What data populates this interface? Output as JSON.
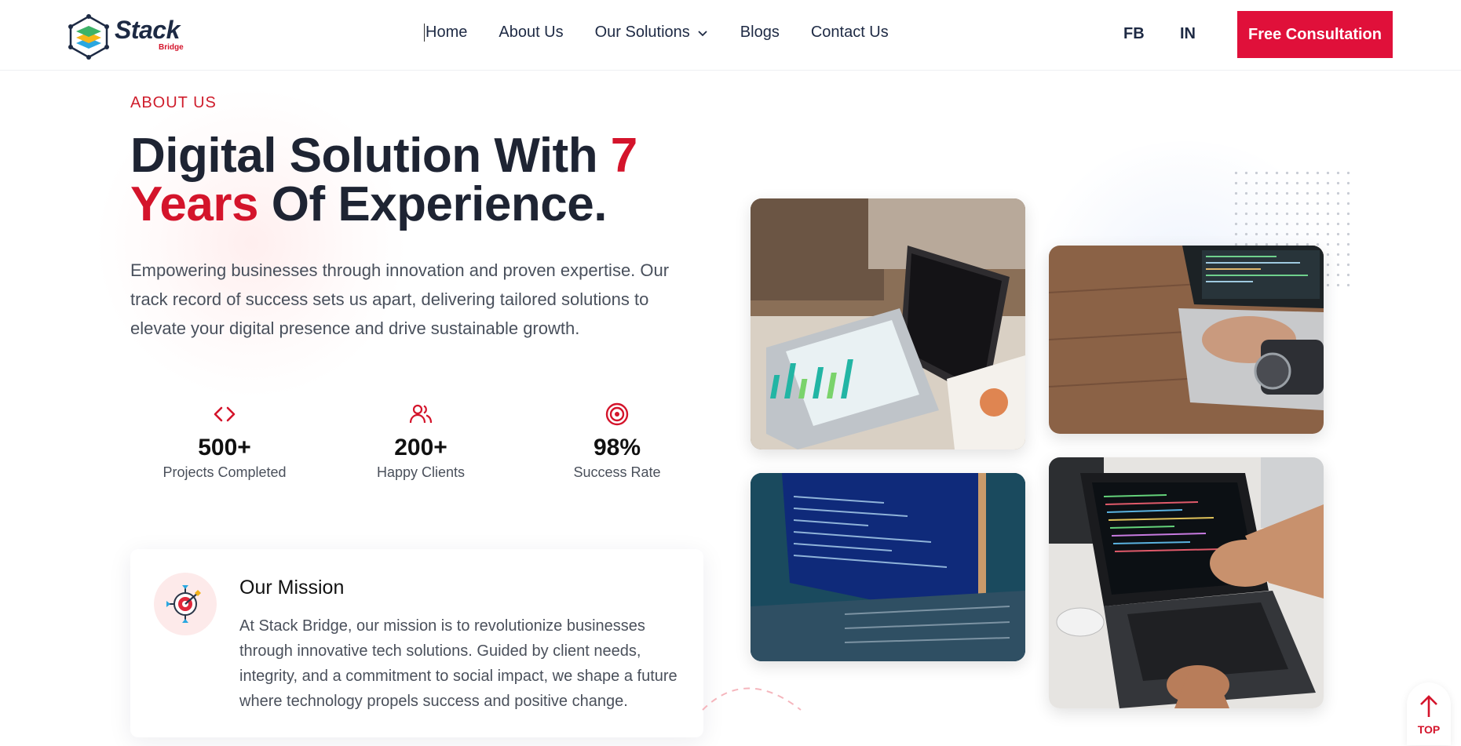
{
  "brand": {
    "name": "Stack",
    "sub": "Bridge"
  },
  "nav": {
    "items": [
      {
        "label": "Home"
      },
      {
        "label": "About Us"
      },
      {
        "label": "Our Solutions"
      },
      {
        "label": "Blogs"
      },
      {
        "label": "Contact Us"
      }
    ],
    "social": [
      "FB",
      "IN"
    ],
    "cta": "Free Consultation"
  },
  "hero": {
    "eyebrow": "ABOUT US",
    "headline_part1": "Digital Solution With ",
    "headline_highlight1": "7",
    "headline_highlight2": "Years",
    "headline_part2": " Of Experience.",
    "description": "Empowering businesses through innovation and proven expertise. Our track record of success sets us apart, delivering tailored solutions to elevate your digital presence and drive sustainable growth."
  },
  "stats": [
    {
      "icon": "code-icon",
      "value": "500+",
      "label": "Projects Completed"
    },
    {
      "icon": "users-icon",
      "value": "200+",
      "label": "Happy Clients"
    },
    {
      "icon": "target-icon",
      "value": "98%",
      "label": "Success Rate"
    }
  ],
  "mission": {
    "icon": "mission-target-icon",
    "title": "Our Mission",
    "text": "At Stack Bridge, our mission is to revolutionize businesses through innovative tech solutions. Guided by client needs, integrity, and a commitment to social impact, we shape a future where technology propels success and positive change."
  },
  "back_to_top": {
    "label": "TOP"
  },
  "colors": {
    "accent": "#d4142b",
    "cta": "#e0103a",
    "text": "#1e2433"
  }
}
